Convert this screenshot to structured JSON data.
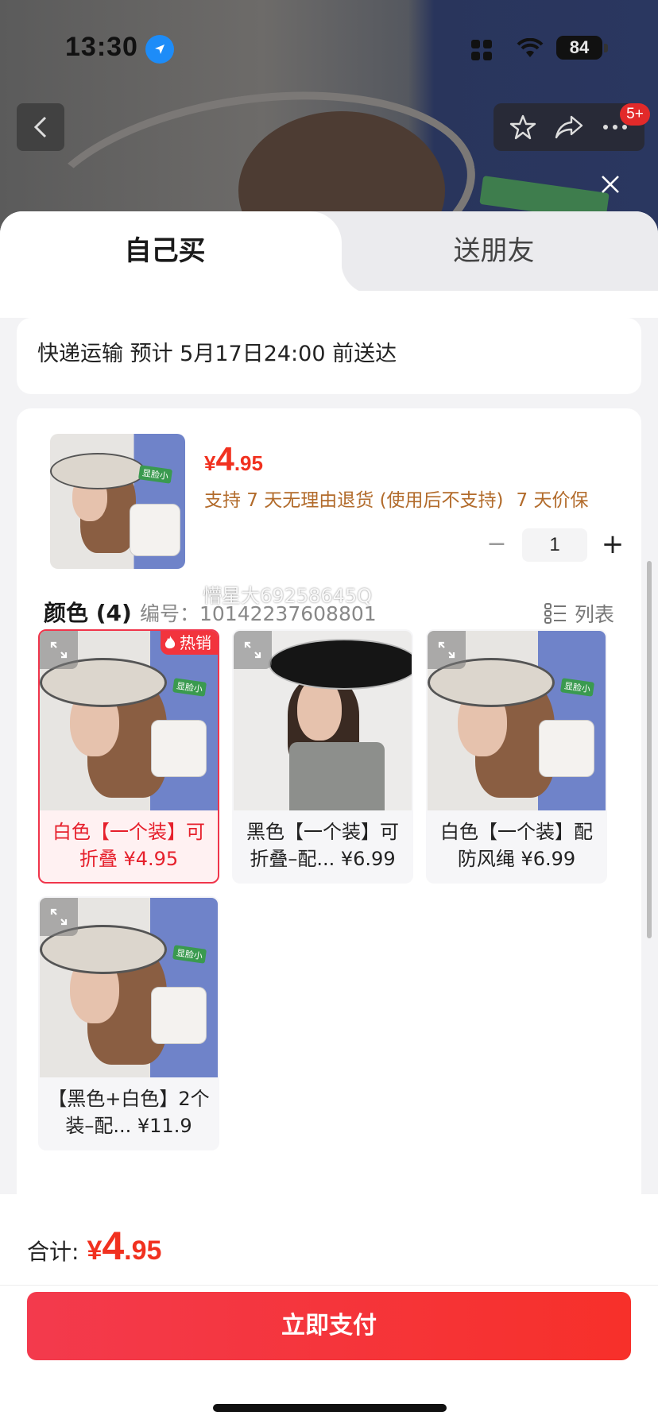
{
  "status_bar": {
    "time": "13:30",
    "battery": "84"
  },
  "nav": {
    "badge": "5+"
  },
  "tabs": {
    "self": "自己买",
    "gift": "送朋友"
  },
  "delivery": {
    "text": "快递运输 预计 5月17日24:00 前送达"
  },
  "product": {
    "price_currency": "¥",
    "price_int": "4",
    "price_dec": ".95",
    "services": [
      "支持 7 天无理由退货 (使用后不支持)",
      "7 天价保"
    ],
    "quantity": "1",
    "image_text": "显脸小"
  },
  "color_section": {
    "title": "颜色 (4)",
    "code": "编号：10142237608801",
    "list_label": "列表"
  },
  "hot_label": "热销",
  "watermark": "懵星大69258645Q",
  "options": [
    {
      "label": "白色【一个装】可折叠 ¥4.95",
      "selected": true
    },
    {
      "label": "黑色【一个装】可折叠–配... ¥6.99",
      "selected": false
    },
    {
      "label": "白色【一个装】配防风绳 ¥6.99",
      "selected": false
    },
    {
      "label": "【黑色+白色】2个装–配... ¥11.9",
      "selected": false
    }
  ],
  "total": {
    "label": "合计:",
    "currency": "¥",
    "int": "4",
    "dec": ".95"
  },
  "pay_button": "立即支付",
  "colors": {
    "accent": "#f1311f",
    "service": "#b26b2b",
    "selected_border": "#f0354b"
  }
}
